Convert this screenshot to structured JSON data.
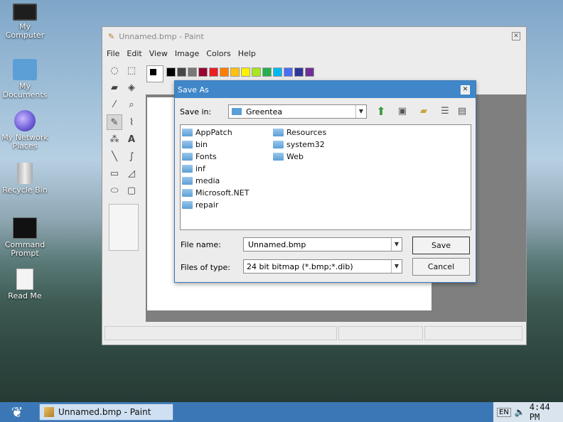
{
  "desktop": {
    "icons": [
      {
        "label1": "My",
        "label2": "Computer",
        "icon": "monitor-icon"
      },
      {
        "label1": "My",
        "label2": "Documents",
        "icon": "folder-icon"
      },
      {
        "label1": "My Network",
        "label2": "Places",
        "icon": "network-globe-icon"
      },
      {
        "label1": "Recycle Bin",
        "label2": "",
        "icon": "recycle-bin-icon"
      },
      {
        "label1": "Command",
        "label2": "Prompt",
        "icon": "command-prompt-icon"
      },
      {
        "label1": "Read Me",
        "label2": "",
        "icon": "document-icon"
      }
    ]
  },
  "paint": {
    "title": "Unnamed.bmp - Paint",
    "menus": [
      "File",
      "Edit",
      "View",
      "Image",
      "Colors",
      "Help"
    ],
    "palette": [
      "#000000",
      "#464646",
      "#787878",
      "#990030",
      "#ed1c24",
      "#ff7e00",
      "#ffc20e",
      "#fff200",
      "#a8e61d",
      "#22b14c",
      "#00b7ef",
      "#4d6df3",
      "#2f3699",
      "#6f3198"
    ],
    "primary_color": "#000000",
    "secondary_color": "#ffffff"
  },
  "dialog": {
    "title": "Save As",
    "save_in_label": "Save in:",
    "save_in_value": "Greentea",
    "files_col1": [
      "AppPatch",
      "bin",
      "Fonts",
      "inf",
      "media",
      "Microsoft.NET",
      "repair"
    ],
    "files_col2": [
      "Resources",
      "system32",
      "Web"
    ],
    "file_name_label": "File name:",
    "file_name_value": "Unnamed.bmp",
    "file_type_label": "Files of type:",
    "file_type_value": "24 bit bitmap (*.bmp;*.dib)",
    "save_label": "Save",
    "cancel_label": "Cancel"
  },
  "taskbar": {
    "task_label": "Unnamed.bmp - Paint",
    "lang": "EN",
    "clock": "4:44 PM"
  }
}
